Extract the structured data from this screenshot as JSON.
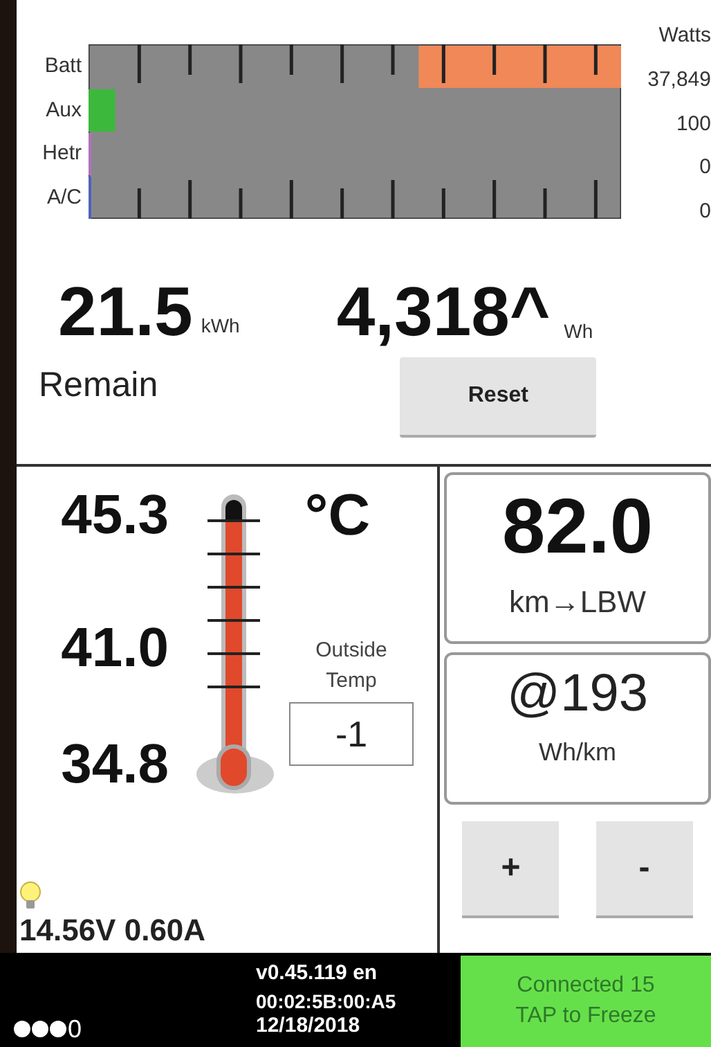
{
  "power_meter": {
    "unit_label": "Watts",
    "rows": [
      {
        "label": "Batt",
        "reading": "37,849",
        "level": 0.38,
        "kind": "right",
        "color": "#f08858"
      },
      {
        "label": "Aux",
        "reading": "100",
        "level": 0.05,
        "kind": "left",
        "color": "#3cb83c"
      },
      {
        "label": "Hetr",
        "reading": "0",
        "level": 0,
        "kind": "left",
        "color": "#b070c0"
      },
      {
        "label": "A/C",
        "reading": "0",
        "level": 0,
        "kind": "left",
        "color": "#5060c0"
      }
    ]
  },
  "energy": {
    "remain_value": "21.5",
    "remain_unit": "kWh",
    "remain_label": "Remain",
    "used_value": "4,318^",
    "used_unit": "Wh",
    "reset_button": "Reset"
  },
  "temperature": {
    "high": "45.3",
    "mid": "41.0",
    "low": "34.8",
    "unit": "°C",
    "outside_label": "Outside Temp",
    "outside_value": "-1"
  },
  "electrical": {
    "reading": "14.56V 0.60A"
  },
  "range": {
    "distance": "82.0",
    "distance_label": "km→LBW",
    "efficiency": "@193",
    "efficiency_label": "Wh/km",
    "buttons": [
      "+",
      "-"
    ]
  },
  "status_bar": {
    "signal": "0",
    "version": "v0.45.119 en",
    "address": "00:02:5B:00:A5",
    "date": "12/18/2018",
    "connection": "Connected 15",
    "connection_hint": "TAP to Freeze"
  }
}
